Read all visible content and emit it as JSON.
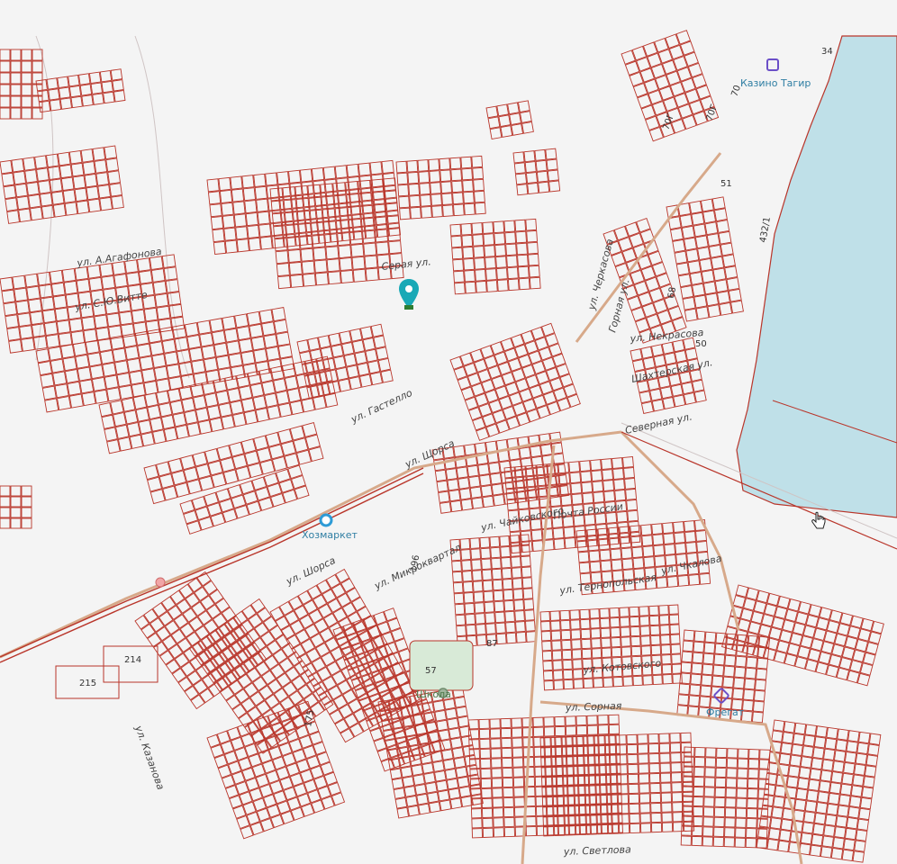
{
  "map": {
    "colors": {
      "background": "#f4f4f4",
      "parcel": "#b9352a",
      "water": "#bfe0e8",
      "road": "#d7a98a",
      "pin": "#19a9b6",
      "poi": "#3a8fbf"
    },
    "street_labels": [
      "ул. А.Агафонова",
      "ул. С.Ю.Витте",
      "Серая ул.",
      "ул. Черкасова",
      "Горная ул.",
      "ул. Некрасова",
      "Шахтерская ул.",
      "Северная ул.",
      "ул. Гастелло",
      "ул. Щорса",
      "ул. Шорса",
      "ул. Микроквартал",
      "ул. Чайковского",
      "ул. Чкалова",
      "ул. Тернопольская",
      "ул. Котовского",
      "ул. Сорная",
      "ул. Казанова",
      "ул. Светлова",
      "Почта России"
    ],
    "parcel_numbers": [
      "34",
      "70",
      "70Г",
      "70Г",
      "51",
      "432/1",
      "68",
      "50",
      "196",
      "87",
      "57",
      "175",
      "214",
      "215"
    ],
    "poi": {
      "kazino": "Казино Тагир",
      "hoz": "Хозмаркет",
      "school": "Школа",
      "fregat": "Фрегат"
    },
    "icons": [
      "location-pin-icon",
      "poi-icon",
      "cursor-hand-icon"
    ]
  }
}
